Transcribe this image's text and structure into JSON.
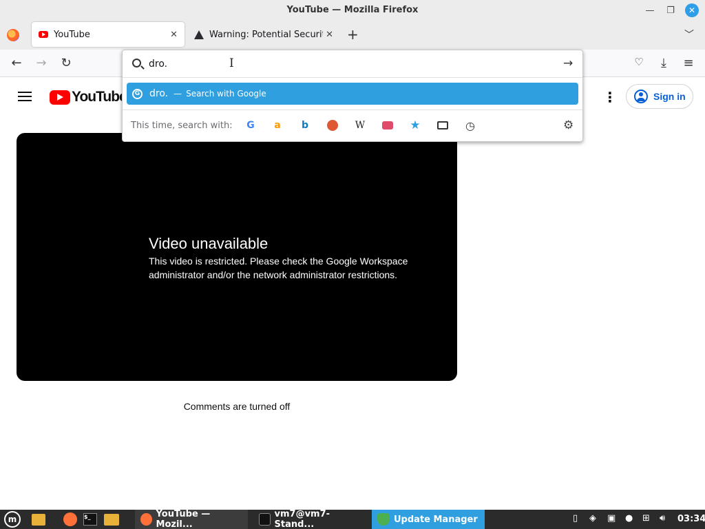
{
  "window": {
    "title": "YouTube — Mozilla Firefox"
  },
  "tabs": [
    {
      "label": "YouTube",
      "active": true,
      "icon": "youtube-favicon"
    },
    {
      "label": "Warning: Potential Security Risk Ahead",
      "active": false,
      "icon": "warning-icon"
    }
  ],
  "urlbar": {
    "value": "dro.",
    "suggestion": {
      "text": "dro.",
      "separator": "—",
      "action": "Search with Google"
    },
    "oneoff_label": "This time, search with:",
    "engines": [
      "Google",
      "Amazon",
      "Bing",
      "DuckDuckGo",
      "Wikipedia",
      "YouTube",
      "Bookmarks",
      "Tabs",
      "History"
    ]
  },
  "youtube": {
    "logo_text": "YouTube",
    "signin_label": "Sign in",
    "video": {
      "title": "Video unavailable",
      "message": "This video is restricted. Please check the Google Workspace administrator and/or the network administrator restrictions."
    },
    "comments": "Comments are turned off"
  },
  "taskbar": {
    "windows": [
      {
        "label": "YouTube — Mozil...",
        "icon": "firefox-icon"
      },
      {
        "label": "vm7@vm7-Stand...",
        "icon": "terminal-icon"
      },
      {
        "label": "Update Manager",
        "icon": "shield-icon"
      }
    ],
    "clock": "03:34"
  },
  "colors": {
    "accent": "#2f9fdf",
    "youtube_red": "#ff0000",
    "signin_blue": "#065fd4"
  }
}
